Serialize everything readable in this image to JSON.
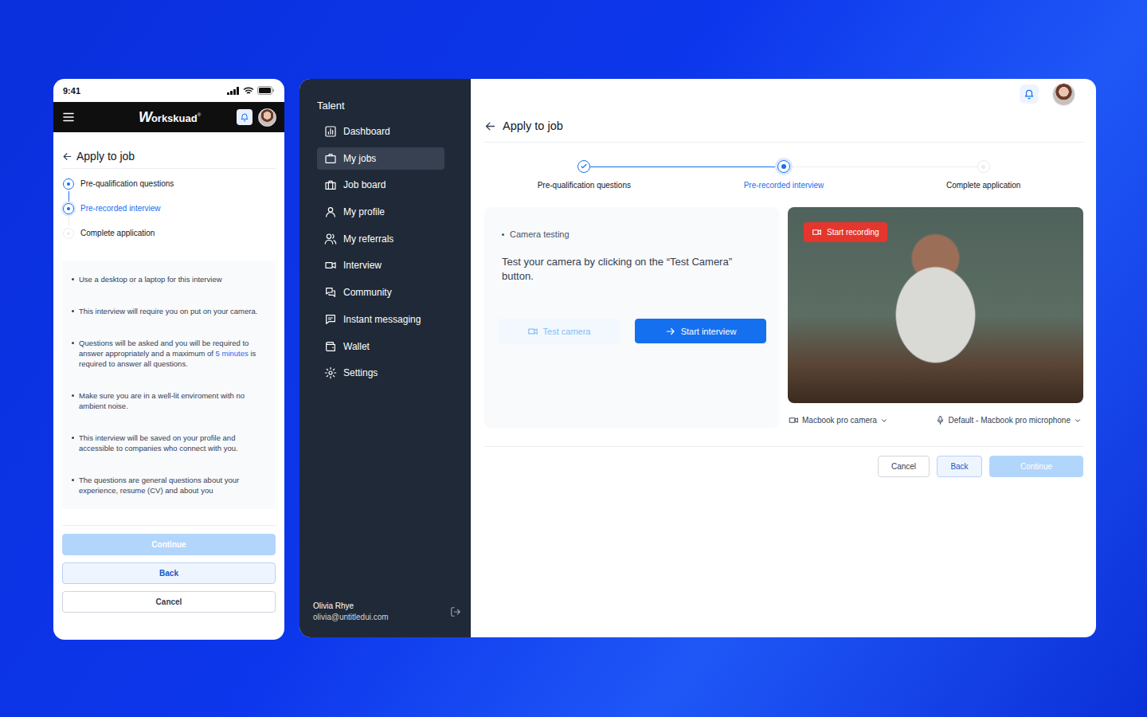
{
  "mobile": {
    "status_bar": {
      "time": "9:41"
    },
    "logo": {
      "mark": "W",
      "text": "orkskuad",
      "registered": "®"
    },
    "page_title": "Apply to job",
    "instructions": [
      [
        {
          "text": "Use a desktop or a laptop for this interview",
          "highlight": false
        }
      ],
      [
        {
          "text": "This interview will require you on put on your camera.",
          "highlight": false
        }
      ],
      [
        {
          "text": "Questions will be asked and you will be required to answer appropriately and a maximum of ",
          "highlight": false
        },
        {
          "text": "5 minutes",
          "highlight": true
        },
        {
          "text": " is required to answer all questions.",
          "highlight": false
        }
      ],
      [
        {
          "text": "Make sure you are in a well-lit enviroment with no ambient noise.",
          "highlight": false
        }
      ],
      [
        {
          "text": "This interview will be saved on your profile and accessible to companies who connect with you.",
          "highlight": false
        }
      ],
      [
        {
          "text": "The questions are general questions about your experience, resume (CV) and about you",
          "highlight": false
        }
      ]
    ],
    "buttons": [
      {
        "label": "Continue",
        "kind": "primary",
        "disabled": true
      },
      {
        "label": "Back",
        "kind": "secondary",
        "disabled": false
      },
      {
        "label": "Cancel",
        "kind": "outline",
        "disabled": false
      }
    ]
  },
  "steps": [
    {
      "label": "Pre-qualification questions",
      "completed": true,
      "selected": false
    },
    {
      "label": "Pre-recorded interview",
      "completed": false,
      "selected": true
    },
    {
      "label": "Complete application",
      "completed": false,
      "selected": false
    }
  ],
  "sidebar": {
    "title": "Talent",
    "items": [
      {
        "label": "Dashboard",
        "selected": false
      },
      {
        "label": "My jobs",
        "selected": true
      },
      {
        "label": "Job board",
        "selected": false
      },
      {
        "label": "My profile",
        "selected": false
      },
      {
        "label": "My referrals",
        "selected": false
      },
      {
        "label": "Interview",
        "selected": false
      },
      {
        "label": "Community",
        "selected": false
      },
      {
        "label": "Instant messaging",
        "selected": false
      },
      {
        "label": "Wallet",
        "selected": false
      },
      {
        "label": "Settings",
        "selected": false
      }
    ],
    "user": {
      "name": "Olivia Rhye",
      "email": "olivia@untitledui.com"
    }
  },
  "desktop": {
    "page_title": "Apply to job",
    "card": {
      "bullet": "Camera testing",
      "text": "Test your camera by clicking on the “Test Camera” button.",
      "buttons": [
        {
          "label": "Test camera",
          "kind": "ghost",
          "disabled": true
        },
        {
          "label": "Start interview",
          "kind": "primary",
          "disabled": false
        }
      ]
    },
    "video": {
      "badge": "Start recording"
    },
    "devices": [
      {
        "label": "Macbook pro camera"
      },
      {
        "label": "Default - Macbook pro microphone"
      }
    ],
    "footer_buttons": [
      {
        "label": "Cancel",
        "kind": "outline",
        "disabled": false
      },
      {
        "label": "Back",
        "kind": "secondary",
        "disabled": false
      },
      {
        "label": "Continue",
        "kind": "primary",
        "disabled": true
      }
    ]
  }
}
